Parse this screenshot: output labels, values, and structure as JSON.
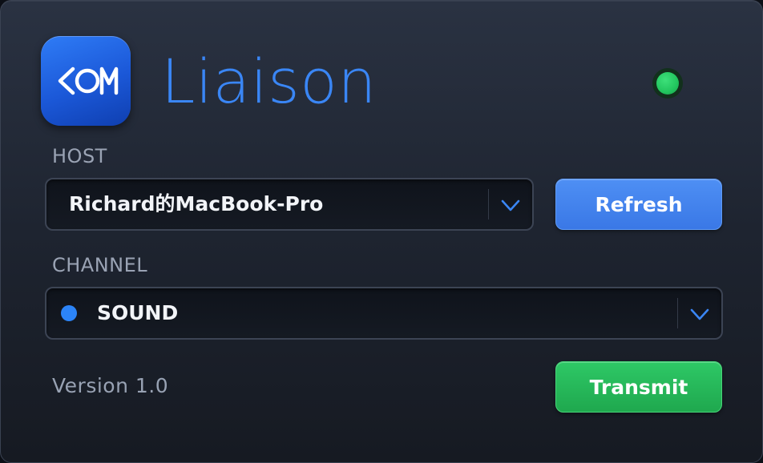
{
  "app": {
    "title": "Liaison",
    "icon_name": "com-logo-icon",
    "brand_color": "#3a86f5",
    "status_color": "#22c55e"
  },
  "host": {
    "label": "HOST",
    "selected": "Richard的MacBook-Pro",
    "refresh_label": "Refresh"
  },
  "channel": {
    "label": "CHANNEL",
    "selected": "SOUND",
    "indicator_color": "#2c84f7"
  },
  "footer": {
    "version": "Version 1.0",
    "transmit_label": "Transmit"
  }
}
